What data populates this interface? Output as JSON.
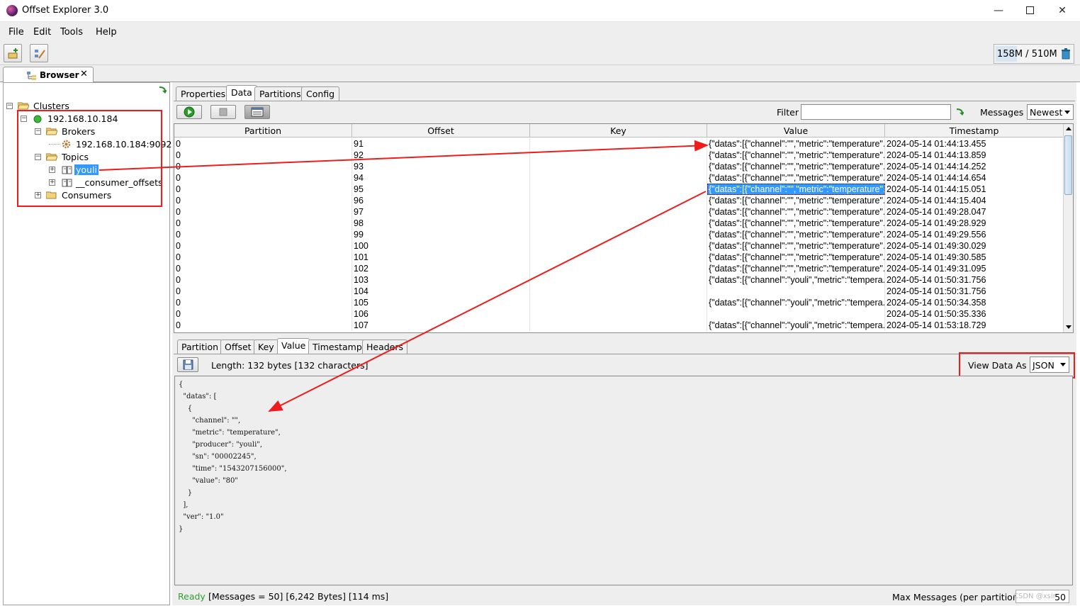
{
  "window": {
    "title": "Offset Explorer  3.0",
    "minimize": "—",
    "close": "✕"
  },
  "menu": [
    "File",
    "Edit",
    "Tools",
    "Help"
  ],
  "toolbar": {
    "memory_used": "158M",
    "memory_sep": " / ",
    "memory_total": "510M"
  },
  "browser_tab": {
    "label": "Browser",
    "close": "✕"
  },
  "tree": {
    "clusters": "Clusters",
    "cluster_ip": "192.168.10.184",
    "brokers": "Brokers",
    "broker_addr": "192.168.10.184:9092",
    "topics": "Topics",
    "topic_selected": "youli",
    "topic_2": "__consumer_offsets",
    "consumers": "Consumers"
  },
  "top_tabs": [
    "Properties",
    "Data",
    "Partitions",
    "Config"
  ],
  "filter": {
    "label": "Filter",
    "value": ""
  },
  "messages": {
    "label": "Messages",
    "value": "Newest"
  },
  "table": {
    "columns": [
      "Partition",
      "Offset",
      "Key",
      "Value",
      "Timestamp"
    ],
    "rows": [
      [
        "0",
        "91",
        "",
        "{\"datas\":[{\"channel\":\"\",\"metric\":\"temperature\"...",
        "2024-05-14 01:44:13.455"
      ],
      [
        "0",
        "92",
        "",
        "{\"datas\":[{\"channel\":\"\",\"metric\":\"temperature\"...",
        "2024-05-14 01:44:13.859"
      ],
      [
        "0",
        "93",
        "",
        "{\"datas\":[{\"channel\":\"\",\"metric\":\"temperature\"...",
        "2024-05-14 01:44:14.252"
      ],
      [
        "0",
        "94",
        "",
        "{\"datas\":[{\"channel\":\"\",\"metric\":\"temperature\"...",
        "2024-05-14 01:44:14.654"
      ],
      [
        "0",
        "95",
        "",
        "{\"datas\":[{\"channel\":\"\",\"metric\":\"temperature\"...",
        "2024-05-14 01:44:15.051"
      ],
      [
        "0",
        "96",
        "",
        "{\"datas\":[{\"channel\":\"\",\"metric\":\"temperature\"...",
        "2024-05-14 01:44:15.404"
      ],
      [
        "0",
        "97",
        "",
        "{\"datas\":[{\"channel\":\"\",\"metric\":\"temperature\"...",
        "2024-05-14 01:49:28.047"
      ],
      [
        "0",
        "98",
        "",
        "{\"datas\":[{\"channel\":\"\",\"metric\":\"temperature\"...",
        "2024-05-14 01:49:28.929"
      ],
      [
        "0",
        "99",
        "",
        "{\"datas\":[{\"channel\":\"\",\"metric\":\"temperature\"...",
        "2024-05-14 01:49:29.556"
      ],
      [
        "0",
        "100",
        "",
        "{\"datas\":[{\"channel\":\"\",\"metric\":\"temperature\"...",
        "2024-05-14 01:49:30.029"
      ],
      [
        "0",
        "101",
        "",
        "{\"datas\":[{\"channel\":\"\",\"metric\":\"temperature\"...",
        "2024-05-14 01:49:30.585"
      ],
      [
        "0",
        "102",
        "",
        "{\"datas\":[{\"channel\":\"\",\"metric\":\"temperature\"...",
        "2024-05-14 01:49:31.095"
      ],
      [
        "0",
        "103",
        "",
        "{\"datas\":[{\"channel\":\"youli\",\"metric\":\"tempera...",
        "2024-05-14 01:50:31.756"
      ],
      [
        "0",
        "104",
        "",
        "",
        "2024-05-14 01:50:31.756"
      ],
      [
        "0",
        "105",
        "",
        "{\"datas\":[{\"channel\":\"youli\",\"metric\":\"tempera...",
        "2024-05-14 01:50:34.358"
      ],
      [
        "0",
        "106",
        "",
        "",
        "2024-05-14 01:50:35.336"
      ],
      [
        "0",
        "107",
        "",
        "{\"datas\":[{\"channel\":\"youli\",\"metric\":\"tempera...",
        "2024-05-14 01:53:18.729"
      ]
    ],
    "selected_row": 4
  },
  "bottom_tabs": [
    "Partition",
    "Offset",
    "Key",
    "Value",
    "Timestamp",
    "Headers"
  ],
  "detail": {
    "length": "Length: 132 bytes [132 characters]",
    "view_as_label": "View Data As",
    "view_as_value": "JSON",
    "json": "{\n  \"datas\": [\n    {\n      \"channel\": \"\",\n      \"metric\": \"temperature\",\n      \"producer\": \"youli\",\n      \"sn\": \"00002245\",\n      \"time\": \"1543207156000\",\n      \"value\": \"80\"\n    }\n  ],\n  \"ver\": \"1.0\"\n}"
  },
  "status": {
    "ready": "Ready",
    "info": "[Messages = 50]  [6,242 Bytes]  [114 ms]",
    "max_label": "Max Messages (per partition)",
    "max_value": "50",
    "watermark": "CSDN @xsir"
  },
  "colors": {
    "annotation": "#ee1c1c",
    "selection": "#3399ff",
    "ready": "#2ea02e"
  }
}
